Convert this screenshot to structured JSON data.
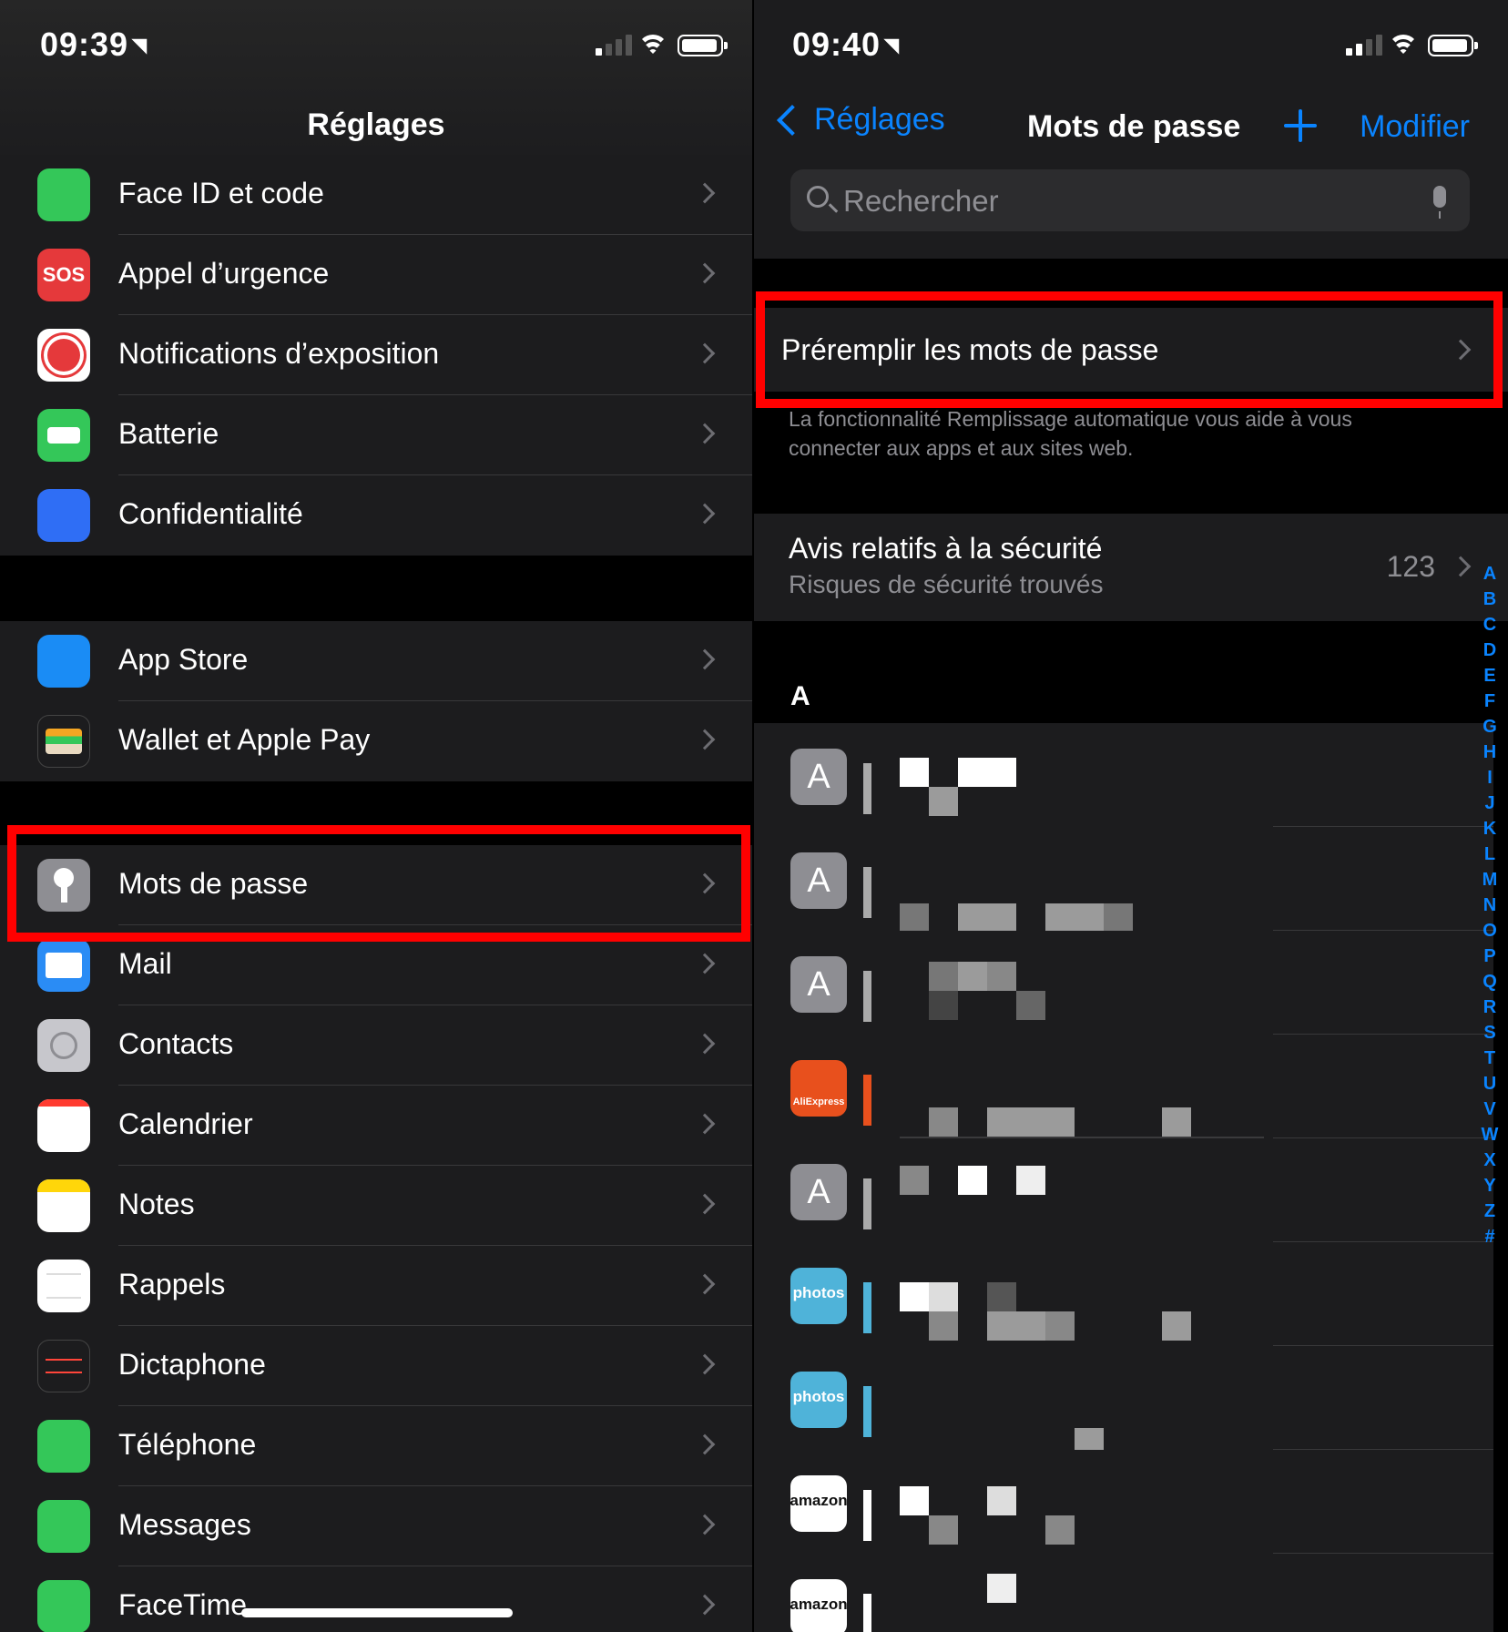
{
  "left": {
    "status": {
      "time": "09:39"
    },
    "title": "Réglages",
    "group1": [
      {
        "label": "Face ID et code",
        "icon": "face-id-icon",
        "color": "#34c759"
      },
      {
        "label": "Appel d’urgence",
        "icon": "sos-icon",
        "color": "#e5393b",
        "glyph": "SOS"
      },
      {
        "label": "Notifications d’exposition",
        "icon": "exposure-icon",
        "color": "#ffffff"
      },
      {
        "label": "Batterie",
        "icon": "battery-icon",
        "color": "#34c759"
      },
      {
        "label": "Confidentialité",
        "icon": "hand-icon",
        "color": "#2f6ef5"
      }
    ],
    "group2": [
      {
        "label": "App Store",
        "icon": "app-store-icon",
        "color": "#1a8cf5"
      },
      {
        "label": "Wallet et Apple Pay",
        "icon": "wallet-icon",
        "color": "#1c1c1e"
      }
    ],
    "group3": [
      {
        "label": "Mots de passe",
        "icon": "key-icon",
        "color": "#8e8e93"
      },
      {
        "label": "Mail",
        "icon": "mail-icon",
        "color": "#2a8cf5"
      },
      {
        "label": "Contacts",
        "icon": "contacts-icon",
        "color": "#c7c7cc"
      },
      {
        "label": "Calendrier",
        "icon": "calendar-icon",
        "color": "#ffffff"
      },
      {
        "label": "Notes",
        "icon": "notes-icon",
        "color": "#ffffff"
      },
      {
        "label": "Rappels",
        "icon": "reminders-icon",
        "color": "#ffffff"
      },
      {
        "label": "Dictaphone",
        "icon": "voice-memo-icon",
        "color": "#1c1c1e"
      },
      {
        "label": "Téléphone",
        "icon": "phone-icon",
        "color": "#34c759"
      },
      {
        "label": "Messages",
        "icon": "messages-icon",
        "color": "#34c759"
      },
      {
        "label": "FaceTime",
        "icon": "facetime-icon",
        "color": "#34c759"
      }
    ]
  },
  "right": {
    "status": {
      "time": "09:40"
    },
    "back_label": "Réglages",
    "title": "Mots de passe",
    "edit_label": "Modifier",
    "search_placeholder": "Rechercher",
    "autofill_label": "Préremplir les mots de passe",
    "autofill_footnote": "La fonctionnalité Remplissage automatique vous aide à vous connecter aux apps et aux sites web.",
    "security": {
      "title": "Avis relatifs à la sécurité",
      "subtitle": "Risques de sécurité trouvés",
      "count": "123"
    },
    "section_letter": "A",
    "accounts": [
      {
        "avatar": "A",
        "type": "letter",
        "color": "#8e8e93"
      },
      {
        "avatar": "A",
        "type": "letter",
        "color": "#8e8e93"
      },
      {
        "avatar": "A",
        "type": "letter",
        "color": "#8e8e93"
      },
      {
        "avatar": "AliExpress",
        "type": "logo",
        "color": "#e8501d"
      },
      {
        "avatar": "A",
        "type": "letter",
        "color": "#8e8e93"
      },
      {
        "avatar": "photos",
        "type": "logo",
        "color": "#4fb3d9"
      },
      {
        "avatar": "photos",
        "type": "logo",
        "color": "#4fb3d9"
      },
      {
        "avatar": "amazon",
        "type": "logo",
        "color": "#ffffff"
      },
      {
        "avatar": "amazon",
        "type": "logo",
        "color": "#ffffff"
      }
    ],
    "index": [
      "A",
      "B",
      "C",
      "D",
      "E",
      "F",
      "G",
      "H",
      "I",
      "J",
      "K",
      "L",
      "M",
      "N",
      "O",
      "P",
      "Q",
      "R",
      "S",
      "T",
      "U",
      "V",
      "W",
      "X",
      "Y",
      "Z",
      "#"
    ]
  },
  "highlight_color": "#ff0000"
}
